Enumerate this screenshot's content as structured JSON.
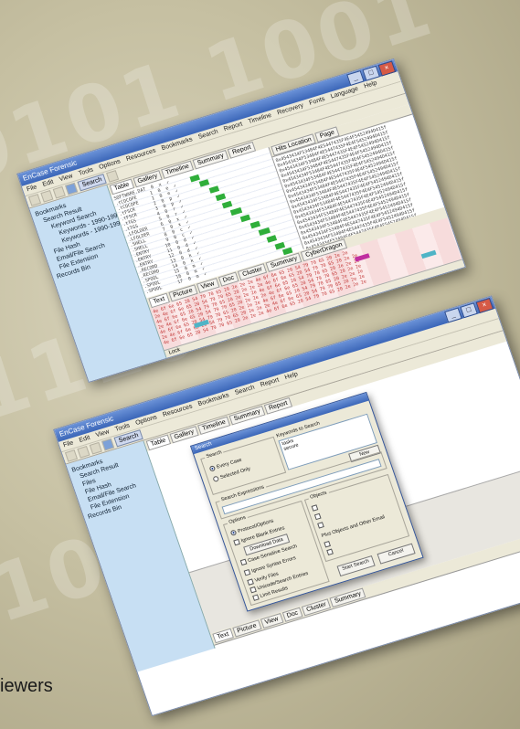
{
  "app": {
    "title": "EnCase Forensic",
    "menu": [
      "File",
      "Edit",
      "View",
      "Tools",
      "Options",
      "Resources",
      "Bookmarks",
      "Search",
      "Report",
      "Refresh",
      "Report",
      "Timeline",
      "Recovery",
      "Fonts",
      "Language",
      "Help"
    ],
    "toolbar_search": "Search"
  },
  "window1": {
    "tree": [
      "Bookmarks",
      "Search Result",
      "Keyword Search",
      "Keywords - 1990-1991",
      "Keywords - 1990-1991",
      "File Hash",
      "Email/File Search",
      "File Extension",
      "Records Bin"
    ],
    "tabs": [
      "Table",
      "Gallery",
      "Timeline",
      "Summary",
      "Report"
    ],
    "right_tabs": [
      "Hits Location",
      "Page"
    ],
    "bottom_tabs": [
      "Text",
      "Picture",
      "View",
      "Doc",
      "Cluster",
      "Summary",
      "CyberDragon"
    ],
    "status": "Lock"
  },
  "window2": {
    "tree": [
      "Bookmarks",
      "Search Result",
      "Files",
      "File Hash",
      "Email/File Search",
      "File Extension",
      "Records Bin"
    ],
    "tabs": [
      "Table",
      "Gallery",
      "Timeline",
      "Summary",
      "Report"
    ],
    "bottom_tabs": [
      "Text",
      "Picture",
      "View",
      "Doc",
      "Cluster",
      "Summary"
    ]
  },
  "dialog": {
    "title": "Search",
    "group_search": "Search",
    "radio_every": "Every Case",
    "radio_selected": "Selected Only",
    "keywords_label": "Keywords to Search",
    "keyword_box": "tasks\nsecure",
    "keyword_actions": [
      "New",
      "Edit"
    ],
    "search_expressions_label": "Search Expressions",
    "options_group": "Options",
    "opt_protocol": "Protocol/Options",
    "opt_ignore_blank": "Ignore Blank Entries",
    "opt_download": "Download Data",
    "opt_case_sensitive": "Case-Sensitive Search",
    "opt_ignore_syntax": "Ignore Syntax Errors",
    "opt_verify": "Verify Files",
    "opt_unicode": "Unicode/Search Entries",
    "opt_limit": "Limit Results",
    "right_group": "Objects",
    "right_group2": "Plus Objects and Other Email",
    "start_button": "Start Search",
    "cancel_button": "Cancel"
  },
  "caption": "iewers"
}
